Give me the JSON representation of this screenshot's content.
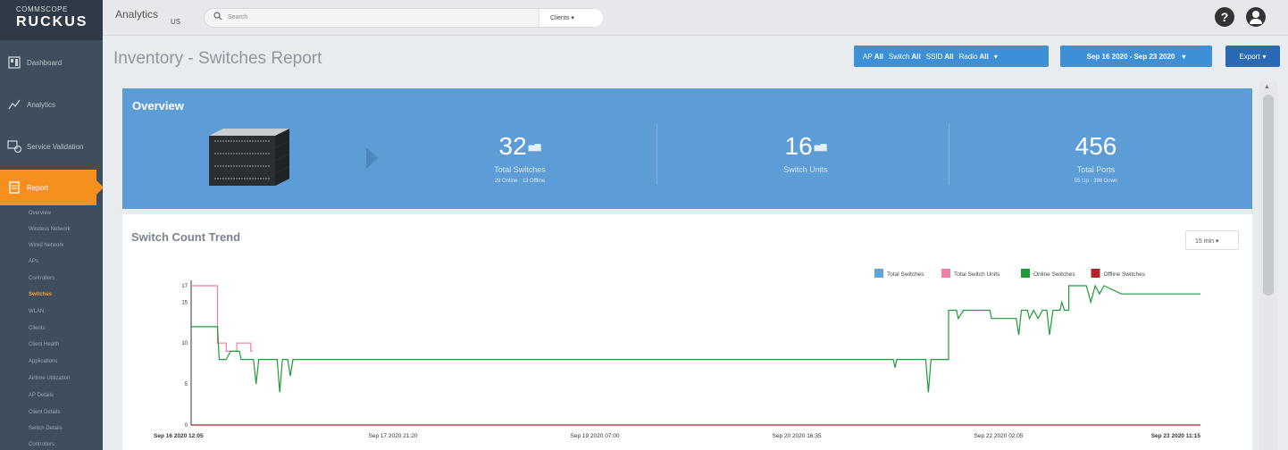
{
  "sidebar": {
    "brand_small": "COMMSCOPE",
    "brand_big": "RUCKUS",
    "items": [
      {
        "label": "Dashboard",
        "icon": "dashboard-icon"
      },
      {
        "label": "Analytics",
        "icon": "analytics-icon"
      },
      {
        "label": "Service Validation",
        "icon": "service-validation-icon"
      },
      {
        "label": "Report",
        "icon": "report-icon",
        "active": true
      }
    ],
    "sub_items": [
      {
        "label": "Overview"
      },
      {
        "label": "Wireless Network"
      },
      {
        "label": "Wired Network"
      },
      {
        "label": "APs"
      },
      {
        "label": "Controllers"
      },
      {
        "label": "Switches",
        "active": true
      },
      {
        "label": "WLAN"
      },
      {
        "label": "Clients"
      },
      {
        "label": "Client Health"
      },
      {
        "label": "Applications"
      },
      {
        "label": "Airtime Utilization"
      },
      {
        "label": "AP Details"
      },
      {
        "label": "Client Details"
      },
      {
        "label": "Switch Details"
      },
      {
        "label": "Controllers"
      }
    ]
  },
  "topbar": {
    "app_name": "Analytics",
    "region": "US",
    "search_placeholder": "Search",
    "client_select": "Clients",
    "help": "?"
  },
  "page": {
    "title": "Inventory - Switches Report"
  },
  "filters": {
    "ap_label": "AP",
    "ap_value": "All",
    "switch_label": "Switch",
    "switch_value": "All",
    "ssid_label": "SSID",
    "ssid_value": "All",
    "radio_label": "Radio",
    "radio_value": "All",
    "date_range": "Sep 16 2020 - Sep 23 2020",
    "export": "Export"
  },
  "overview": {
    "title": "Overview",
    "stats": [
      {
        "value": "32",
        "label": "Total Switches",
        "sub": "29 Online · 13 Offline"
      },
      {
        "value": "16",
        "label": "Switch Units",
        "sub": ""
      },
      {
        "value": "456",
        "label": "Total Ports",
        "sub": "55 Up · 398 Down"
      }
    ]
  },
  "trend": {
    "title": "Switch Count Trend",
    "interval": "15 min",
    "legend": [
      {
        "name": "Total Switches",
        "color": "#5ea5dd"
      },
      {
        "name": "Total Switch Units",
        "color": "#f07ea6"
      },
      {
        "name": "Online Switches",
        "color": "#1e9a3a"
      },
      {
        "name": "Offline Switches",
        "color": "#b12229"
      }
    ]
  },
  "chart_data": {
    "type": "line",
    "title": "Switch Count Trend",
    "x_ticks": [
      "Sep 16 2020 12:05",
      "Sep 17 2020 21:20",
      "Sep 19 2020 07:00",
      "Sep 20 2020 16:35",
      "Sep 22 2020 02:05",
      "Sep 23 2020 11:15"
    ],
    "y_ticks": [
      0,
      5,
      10,
      15,
      17
    ],
    "ylim": [
      0,
      17
    ],
    "series": [
      {
        "name": "Total Switch Units",
        "color": "#f07ea6",
        "points": [
          [
            0.0,
            17
          ],
          [
            0.03,
            17
          ],
          [
            0.03,
            10
          ],
          [
            0.04,
            10
          ],
          [
            0.04,
            9
          ],
          [
            0.052,
            9
          ],
          [
            0.052,
            10
          ],
          [
            0.068,
            10
          ],
          [
            0.068,
            9
          ],
          [
            0.07,
            9
          ]
        ]
      },
      {
        "name": "Online Switches",
        "color": "#1e9a3a",
        "points": [
          [
            0.0,
            12
          ],
          [
            0.028,
            12
          ],
          [
            0.03,
            12
          ],
          [
            0.032,
            8
          ],
          [
            0.04,
            8
          ],
          [
            0.045,
            9
          ],
          [
            0.055,
            9
          ],
          [
            0.057,
            8
          ],
          [
            0.068,
            8
          ],
          [
            0.071,
            8
          ],
          [
            0.074,
            5
          ],
          [
            0.077,
            8
          ],
          [
            0.098,
            8
          ],
          [
            0.101,
            4
          ],
          [
            0.104,
            8
          ],
          [
            0.11,
            8
          ],
          [
            0.113,
            6
          ],
          [
            0.116,
            8
          ],
          [
            0.8,
            8
          ],
          [
            0.802,
            7
          ],
          [
            0.804,
            8
          ],
          [
            0.837,
            8
          ],
          [
            0.84,
            4
          ],
          [
            0.843,
            8
          ],
          [
            0.863,
            8
          ],
          [
            0.863,
            14
          ],
          [
            0.872,
            14
          ],
          [
            0.874,
            13
          ],
          [
            0.88,
            14
          ],
          [
            0.91,
            14
          ],
          [
            0.912,
            13
          ],
          [
            0.94,
            13
          ],
          [
            0.943,
            11
          ],
          [
            0.946,
            14
          ],
          [
            0.953,
            14
          ],
          [
            0.955,
            13
          ],
          [
            0.96,
            14
          ],
          [
            0.965,
            13
          ],
          [
            0.97,
            14
          ],
          [
            0.975,
            14
          ],
          [
            0.978,
            11
          ],
          [
            0.982,
            14
          ],
          [
            0.988,
            14
          ],
          [
            0.99,
            14
          ],
          [
            0.992,
            15
          ],
          [
            0.995,
            14
          ],
          [
            1.0,
            14
          ],
          [
            1.0,
            17
          ],
          [
            1.02,
            17
          ],
          [
            1.025,
            15
          ],
          [
            1.03,
            17
          ],
          [
            1.035,
            16
          ],
          [
            1.04,
            17
          ],
          [
            1.06,
            16
          ],
          [
            1.15,
            16
          ]
        ]
      },
      {
        "name": "Offline Switches",
        "color": "#b12229",
        "points": [
          [
            0.0,
            0
          ],
          [
            1.15,
            0
          ]
        ]
      }
    ]
  }
}
